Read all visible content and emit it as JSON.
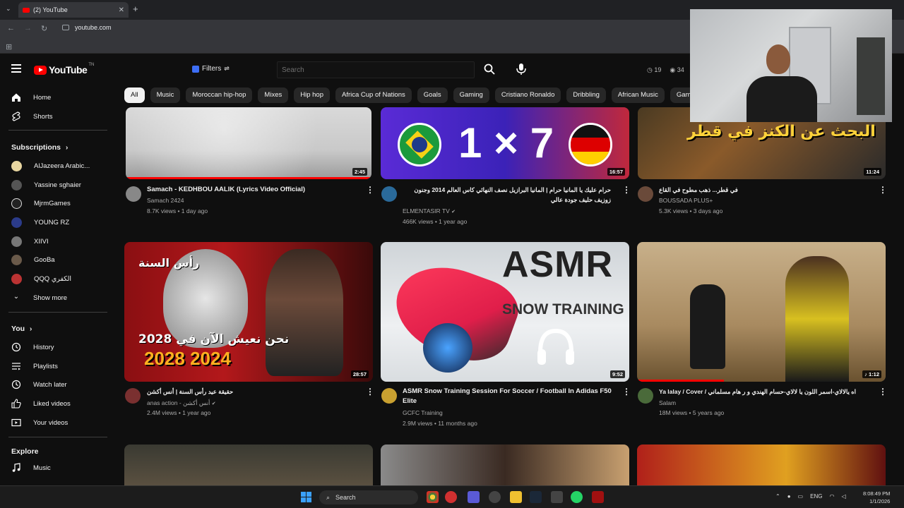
{
  "browser": {
    "tab_title": "(2) YouTube",
    "new_tab": "+",
    "url": "youtube.com"
  },
  "header": {
    "logo_text": "YouTube",
    "logo_country": "TN",
    "filters_label": "Filters",
    "search_placeholder": "Search",
    "ext_1": "19",
    "ext_2": "34"
  },
  "chips": [
    "All",
    "Music",
    "Moroccan hip-hop",
    "Mixes",
    "Hip hop",
    "Africa Cup of Nations",
    "Goals",
    "Gaming",
    "Cristiano Ronaldo",
    "Dribbling",
    "African Music",
    "Game shows"
  ],
  "sidebar": {
    "home": "Home",
    "shorts": "Shorts",
    "subscriptions_header": "Subscriptions",
    "subscriptions": [
      "AlJazeera Arabic...",
      "Yassine sghaier",
      "MjrmGames",
      "YOUNG RZ",
      "XIIVI",
      "GooBa",
      "QQQ الكفري"
    ],
    "show_more": "Show more",
    "you_header": "You",
    "you_items": [
      "History",
      "Playlists",
      "Watch later",
      "Liked videos",
      "Your videos"
    ],
    "explore_header": "Explore",
    "explore_items": [
      "Music"
    ]
  },
  "videos": [
    {
      "title": "Samach - KEDHBOU AALIK (Lyrics Video Official)",
      "channel": "Samach 2424",
      "meta": "8.7K views • 1 day ago",
      "duration": "2:45",
      "thumb_text": "",
      "progress": 1.0
    },
    {
      "title": "حرام عليك يا المانيا حرام | المانيا البرازيل نصف النهائي كاس العالم 2014 وجنون زوزيف حليف جودة عالي",
      "channel": "ELMENTASIR TV",
      "meta": "466K views • 1 year ago",
      "duration": "16:57",
      "thumb_text": "1 × 7",
      "progress": 0
    },
    {
      "title": "في قطر... ذهب مطوح في القاع",
      "channel": "BOUSSADA PLUS+",
      "meta": "5.3K views • 3 days ago",
      "duration": "11:24",
      "thumb_text": "البحث عن الكنز في قطر",
      "progress": 0
    },
    {
      "title": "حقيقة عيد رأس السنة | أنس أكشن",
      "channel": "anas action - أنس أكشن",
      "meta": "2.4M views • 1 year ago",
      "duration": "28:57",
      "thumb_text": "نحن نعيش الآن في 2028",
      "thumb_text_2": "رأس السنة",
      "thumb_text_3": "2028 2024",
      "progress": 0
    },
    {
      "title": "ASMR Snow Training Session For Soccer / Football In Adidas F50 Elite",
      "channel": "GCFC Training",
      "meta": "2.9M views • 11 months ago",
      "duration": "9:52",
      "thumb_text": "ASMR",
      "thumb_text_2": "SNOW TRAINING",
      "progress": 0
    },
    {
      "title": "Ya lalay / Cover / اه يالالاي-اسمر اللون يا لالاي-حسام الهندي و ر هام مسلماني",
      "channel": "Salam",
      "meta": "18M views • 5 years ago",
      "duration": "1:12",
      "thumb_text": "",
      "progress": 0.35
    }
  ],
  "taskbar": {
    "search_label": "Search",
    "lang": "ENG",
    "time": "8:08:49 PM",
    "date": "1/1/2026"
  },
  "colors": {
    "accent": "#ff0000",
    "background": "#0f0f0f",
    "chip": "#272727"
  }
}
